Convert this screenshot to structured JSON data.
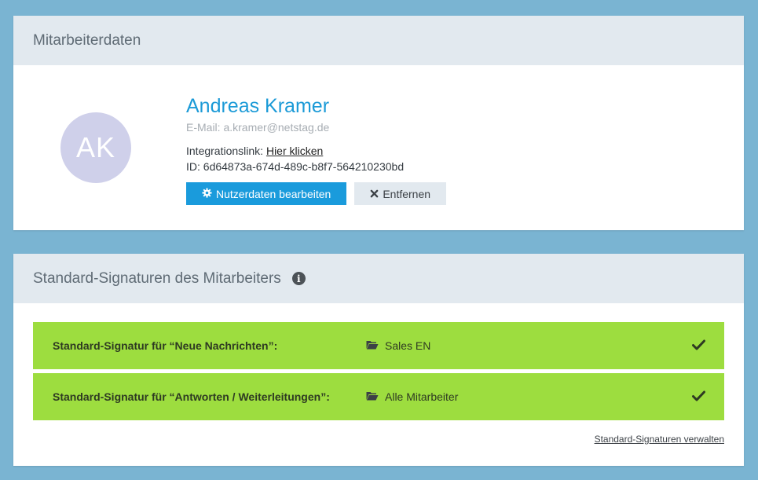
{
  "employee_card": {
    "title": "Mitarbeiterdaten",
    "avatar_initials": "AK",
    "name": "Andreas Kramer",
    "email_line": "E-Mail: a.kramer@netstag.de",
    "integration_label": "Integrationslink:",
    "integration_link": "Hier klicken",
    "id_line": "ID: 6d64873a-674d-489c-b8f7-564210230bd",
    "edit_button": "Nutzerdaten bearbeiten",
    "remove_button": "Entfernen"
  },
  "signatures_card": {
    "title": "Standard-Signaturen des Mitarbeiters",
    "rows": [
      {
        "label": "Standard-Signatur für “Neue Nachrichten”:",
        "value": "Sales EN"
      },
      {
        "label": "Standard-Signatur für “Antworten / Weiterleitungen”:",
        "value": "Alle Mitarbeiter"
      }
    ],
    "manage_link": "Standard-Signaturen verwalten"
  },
  "icons": {
    "edit": "gear-icon",
    "remove": "close-icon",
    "info": "info-icon",
    "folder": "folder-open-icon",
    "check": "check-icon"
  },
  "colors": {
    "accent": "#1a9bdc",
    "name": "#1b9ad7",
    "success_row": "#9ddd3f",
    "header_bg": "#e2e9ef",
    "avatar_bg": "#cfd0ea",
    "page_bg": "#7ab4d2"
  }
}
